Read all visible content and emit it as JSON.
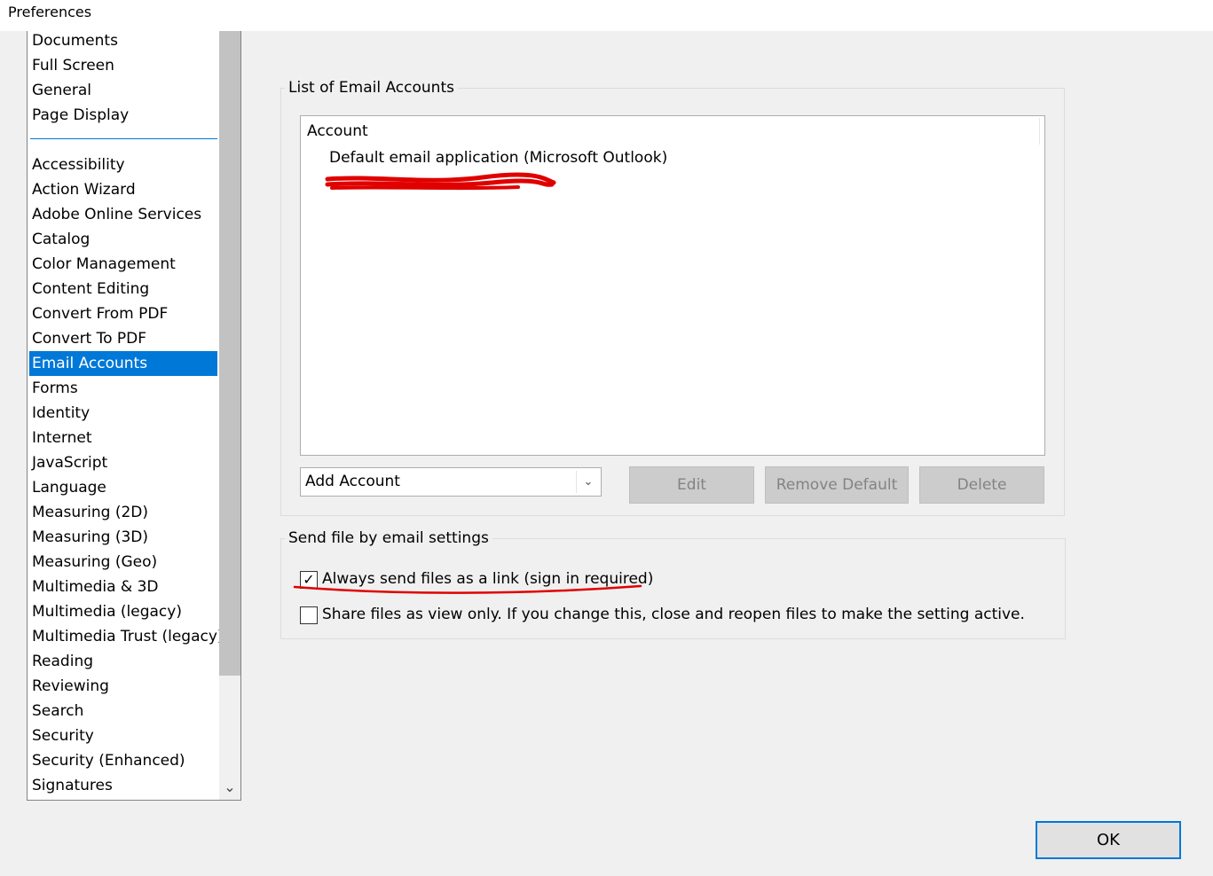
{
  "window": {
    "title": "Preferences"
  },
  "categories": {
    "group1": [
      "Documents",
      "Full Screen",
      "General",
      "Page Display"
    ],
    "group2": [
      "Accessibility",
      "Action Wizard",
      "Adobe Online Services",
      "Catalog",
      "Color Management",
      "Content Editing",
      "Convert From PDF",
      "Convert To PDF",
      "Email Accounts",
      "Forms",
      "Identity",
      "Internet",
      "JavaScript",
      "Language",
      "Measuring (2D)",
      "Measuring (3D)",
      "Measuring (Geo)",
      "Multimedia & 3D",
      "Multimedia (legacy)",
      "Multimedia Trust (legacy)",
      "Reading",
      "Reviewing",
      "Search",
      "Security",
      "Security (Enhanced)",
      "Signatures"
    ],
    "selected": "Email Accounts"
  },
  "email_accounts": {
    "group_title": "List of Email Accounts",
    "column_header": "Account",
    "accounts": [
      "Default email application (Microsoft Outlook)"
    ],
    "add_account": {
      "selected": "Add Account"
    },
    "buttons": {
      "edit": "Edit",
      "remove_default": "Remove Default",
      "delete": "Delete"
    }
  },
  "send_settings": {
    "group_title": "Send file by email settings",
    "options": [
      {
        "label": "Always send files as a link (sign in required)",
        "checked": true
      },
      {
        "label": "Share files as view only. If you change this, close and reopen files to make the setting active.",
        "checked": false
      }
    ]
  },
  "footer": {
    "ok_label": "OK"
  },
  "colors": {
    "selection": "#0078d7",
    "annotation": "#e00000"
  },
  "icons": {
    "scroll_down": "chevron-down-icon",
    "dropdown": "chevron-down-icon",
    "check": "checkmark-icon"
  }
}
